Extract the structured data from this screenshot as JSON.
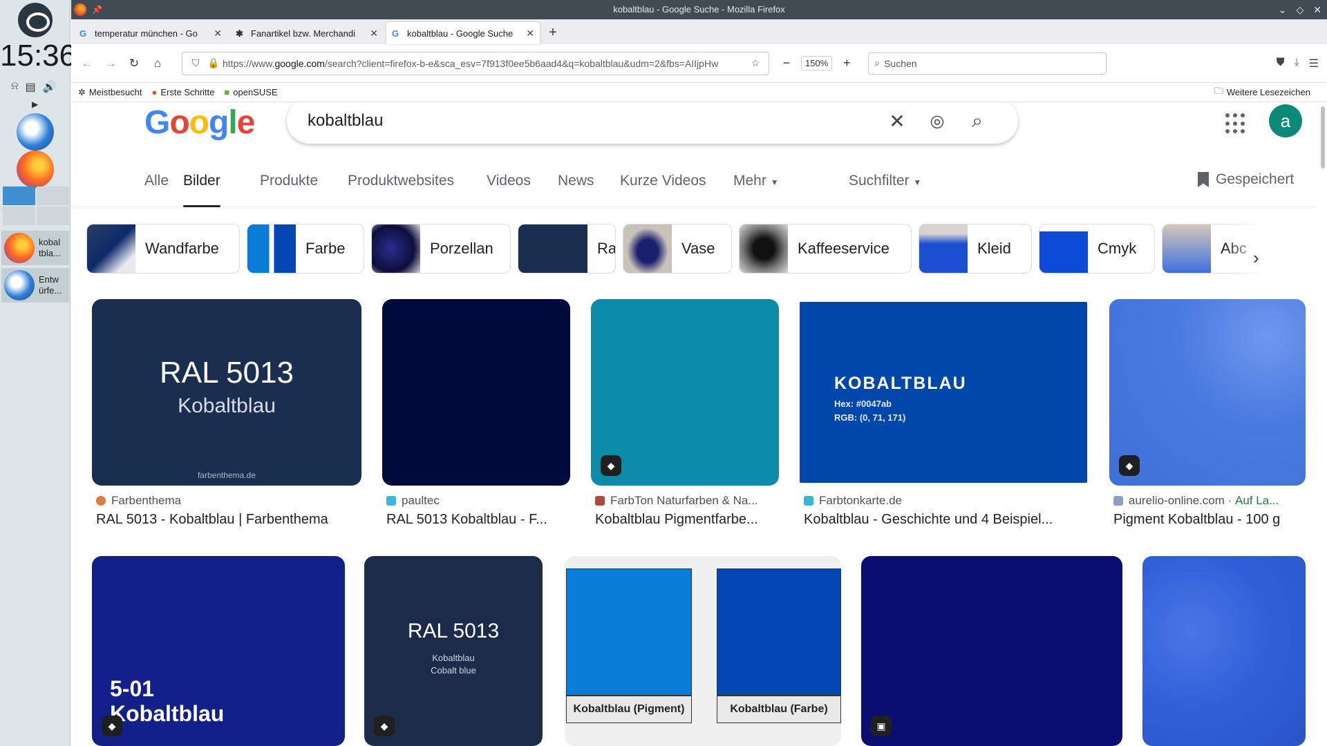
{
  "panel": {
    "clock": "15:36",
    "tasks": [
      "kobal tbla...",
      "Entw ürfe..."
    ]
  },
  "window": {
    "title": "kobaltblau - Google Suche - Mozilla Firefox"
  },
  "tabs": [
    {
      "title": "temperatur münchen - Go",
      "active": false
    },
    {
      "title": "Fanartikel bzw. Merchandi",
      "active": false
    },
    {
      "title": "kobaltblau - Google Suche",
      "active": true
    }
  ],
  "nav": {
    "url_prefix": "https://www.",
    "url_host": "google.com",
    "url_rest": "/search?client=firefox-b-e&sca_esv=7f913f0ee5b6aad4&q=kobaltblau&udm=2&fbs=AIIjpHw",
    "zoom": "150%",
    "search_placeholder": "Suchen"
  },
  "bookmarks": {
    "items": [
      "Meistbesucht",
      "Erste Schritte",
      "openSUSE"
    ],
    "more": "Weitere Lesezeichen"
  },
  "google": {
    "query": "kobaltblau",
    "avatar": "a",
    "tabs": [
      "Alle",
      "Bilder",
      "Produkte",
      "Produktwebsites",
      "Videos",
      "News",
      "Kurze Videos",
      "Mehr",
      "Suchfilter"
    ],
    "active_tab": "Bilder",
    "saved": "Gespeichert",
    "chips": [
      "Wandfarbe",
      "Farbe",
      "Porzellan",
      "Ral",
      "Vase",
      "Kaffeeservice",
      "Kleid",
      "Cmyk",
      "Abc"
    ]
  },
  "results_row1": [
    {
      "source": "Farbenthema",
      "title": "RAL 5013 - Kobaltblau | Farbenthema",
      "img_title": "RAL 5013",
      "img_sub": "Kobaltblau",
      "img_foot": "farbenthema.de",
      "color": "#1a2e4f"
    },
    {
      "source": "paultec",
      "title": "RAL 5013 Kobaltblau - F...",
      "color": "#010a3d"
    },
    {
      "source": "FarbTon Naturfarben & Na...",
      "title": "Kobaltblau Pigmentfarbe...",
      "color": "#0c8ba8"
    },
    {
      "source": "Farbtonkarte.de",
      "title": "Kobaltblau - Geschichte und 4 Beispiel...",
      "img_title": "KOBALTBLAU",
      "img_hex": "Hex: #0047ab",
      "img_rgb": "RGB: (0, 71, 171)",
      "color": "#0047ab"
    },
    {
      "source": "aurelio-online.com",
      "source_extra": "Auf La...",
      "title": "Pigment Kobaltblau - 100 g",
      "color": "#4a7be0"
    }
  ],
  "results_row2": [
    {
      "img_title": "5-01",
      "img_sub": "Kobaltblau",
      "color": "#14208a"
    },
    {
      "img_title": "RAL 5013",
      "img_sub": "Kobaltblau",
      "img_sub2": "Cobalt blue",
      "color": "#1d2b4a"
    },
    {
      "label_a": "Kobaltblau (Pigment)",
      "label_b": "Kobaltblau (Farbe)",
      "color_a": "#0a7bd6",
      "color_b": "#0546b5"
    },
    {
      "color": "#0a0d72"
    },
    {
      "color": "#2f5fd8"
    }
  ]
}
